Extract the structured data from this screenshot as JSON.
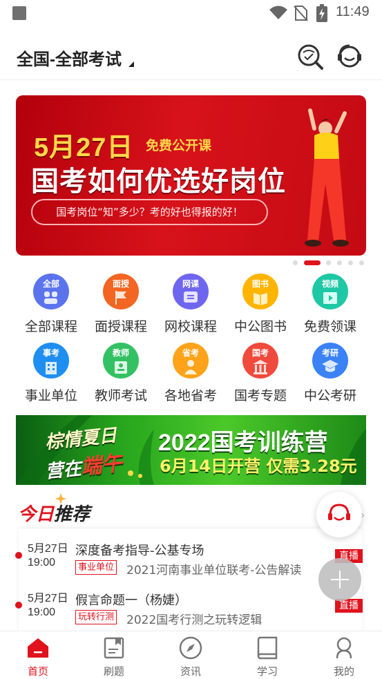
{
  "status_bar": {
    "time": "11:49"
  },
  "header": {
    "region_label": "全国-全部考试"
  },
  "banner": {
    "date": "5月27日",
    "tag": "免费公开课",
    "title": "国考如何优选好岗位",
    "subtitle": "国考岗位“知”多少？考的好也得报的好！",
    "active_index": 1,
    "count": 7
  },
  "categories": [
    {
      "label": "全部课程",
      "mini": "全部",
      "color": "#5b74ee",
      "icon": "grid-icon"
    },
    {
      "label": "面授课程",
      "mini": "面授",
      "color": "#f26522",
      "icon": "flag-icon"
    },
    {
      "label": "网校课程",
      "mini": "网课",
      "color": "#6f66f0",
      "icon": "screen-icon"
    },
    {
      "label": "中公图书",
      "mini": "图书",
      "color": "#ffb400",
      "icon": "book-icon"
    },
    {
      "label": "免费领课",
      "mini": "视频",
      "color": "#1ec8a5",
      "icon": "video-icon"
    },
    {
      "label": "事业单位",
      "mini": "事考",
      "color": "#1f8ef1",
      "icon": "building-icon"
    },
    {
      "label": "教师考试",
      "mini": "教师",
      "color": "#34c164",
      "icon": "teacher-icon"
    },
    {
      "label": "各地省考",
      "mini": "省考",
      "color": "#ffa31a",
      "icon": "person-icon"
    },
    {
      "label": "国考专题",
      "mini": "国考",
      "color": "#ef4a3c",
      "icon": "hall-icon"
    },
    {
      "label": "中公考研",
      "mini": "考研",
      "color": "#3b82f6",
      "icon": "graduation-icon"
    }
  ],
  "promo": {
    "left_line1": "棕情夏日",
    "left_line2_a": "营在",
    "left_line2_b": "端午",
    "title": "2022国考训练营",
    "subtitle": "6月14日开营 仅需3.28元"
  },
  "recommend": {
    "title_red": "今日",
    "title_dark": "推荐",
    "items": [
      {
        "date": "5月27日",
        "time": "19:00",
        "name": "深度备考指导-公基专场",
        "tag": "事业单位",
        "desc": "2021河南事业单位联考-公告解读",
        "live": "直播"
      },
      {
        "date": "5月27日",
        "time": "19:00",
        "name": "假言命题一（杨婕）",
        "tag": "玩转行测",
        "desc": "2022国考行测之玩转逻辑",
        "live": "直播"
      }
    ]
  },
  "bottom_nav": [
    {
      "label": "首页",
      "icon": "home-icon",
      "active": true
    },
    {
      "label": "刷题",
      "icon": "practice-icon",
      "active": false
    },
    {
      "label": "资讯",
      "icon": "compass-icon",
      "active": false
    },
    {
      "label": "学习",
      "icon": "study-icon",
      "active": false
    },
    {
      "label": "我的",
      "icon": "profile-icon",
      "active": false
    }
  ],
  "colors": {
    "brand_red": "#e0121c",
    "banner_red": "#d7121a",
    "promo_green": "#27a51d"
  }
}
